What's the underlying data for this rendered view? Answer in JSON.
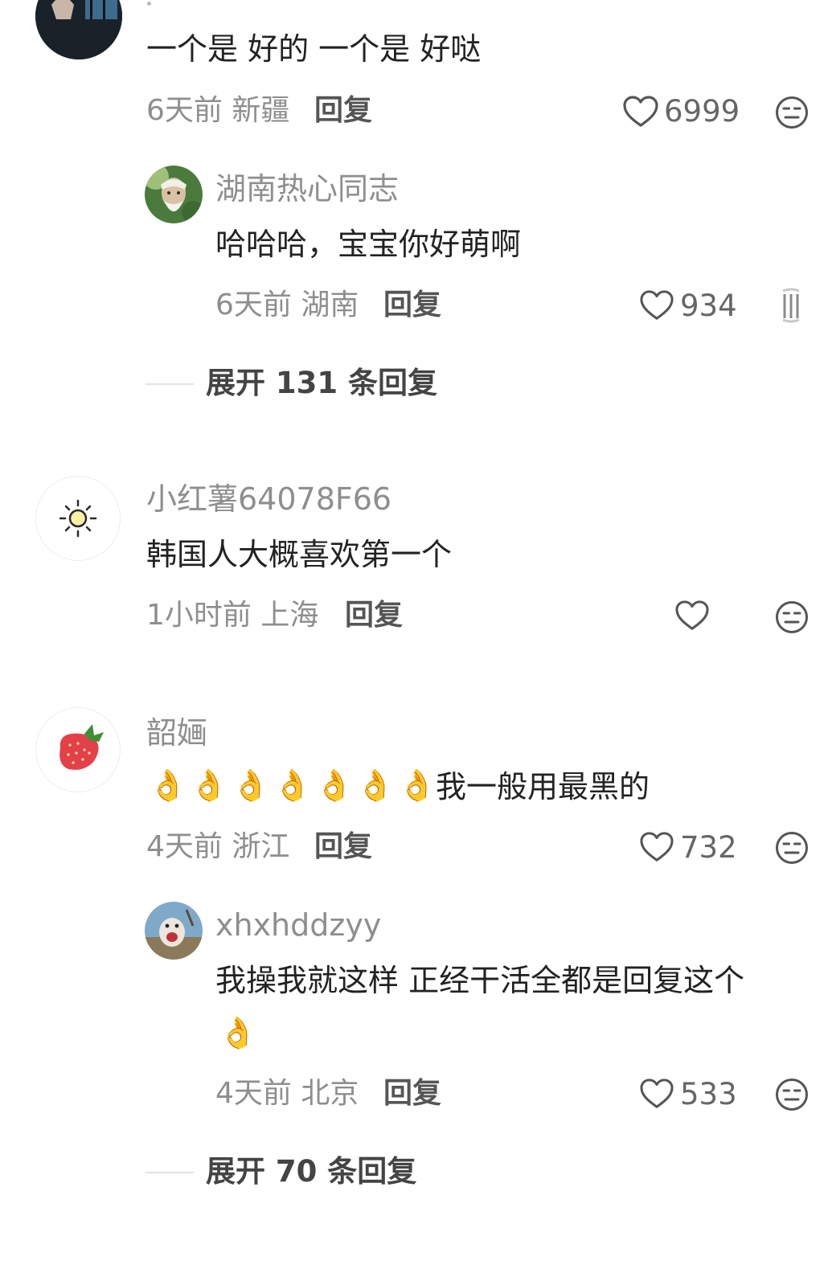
{
  "comments": [
    {
      "content": "一个是 好的 一个是 好哒",
      "time": "6天前",
      "location": "新疆",
      "reply_label": "回复",
      "likes": "6999",
      "avatar_icon": "dark-photo-avatar-icon"
    },
    {
      "username": "湖南热心同志",
      "content": "哈哈哈，宝宝你好萌啊",
      "time": "6天前",
      "location": "湖南",
      "reply_label": "回复",
      "likes": "934",
      "avatar_icon": "old-man-avatar-icon"
    },
    {
      "username": "小红薯64078F66",
      "content": "韩国人大概喜欢第一个",
      "time": "1小时前",
      "location": "上海",
      "reply_label": "回复",
      "avatar_icon": "sun-avatar-icon"
    },
    {
      "username": "韶婳",
      "content": "我一般用最黑的",
      "emoji": [
        "👌",
        "👌",
        "👌",
        "👌",
        "👌",
        "👌",
        "👌"
      ],
      "time": "4天前",
      "location": "浙江",
      "reply_label": "回复",
      "likes": "732",
      "avatar_icon": "strawberry-avatar-icon"
    },
    {
      "username": "xhxhddzyy",
      "content": "我操我就这样 正经干活全都是回复这个",
      "emoji": "👌",
      "time": "4天前",
      "location": "北京",
      "reply_label": "回复",
      "likes": "533",
      "avatar_icon": "animal-photo-avatar-icon"
    }
  ],
  "expand": [
    {
      "label": "展开 131 条回复"
    },
    {
      "label": "展开 70 条回复"
    }
  ],
  "colors": {
    "muted_text": "#8e8e8e",
    "body_text": "#222222",
    "divider": "#e2e2e2",
    "ok_skin_tones": [
      "#f06a7d",
      "#f7c326",
      "#f6dcc1",
      "#dfb18c",
      "#b98560",
      "#8d5a35",
      "#4a3328"
    ]
  }
}
